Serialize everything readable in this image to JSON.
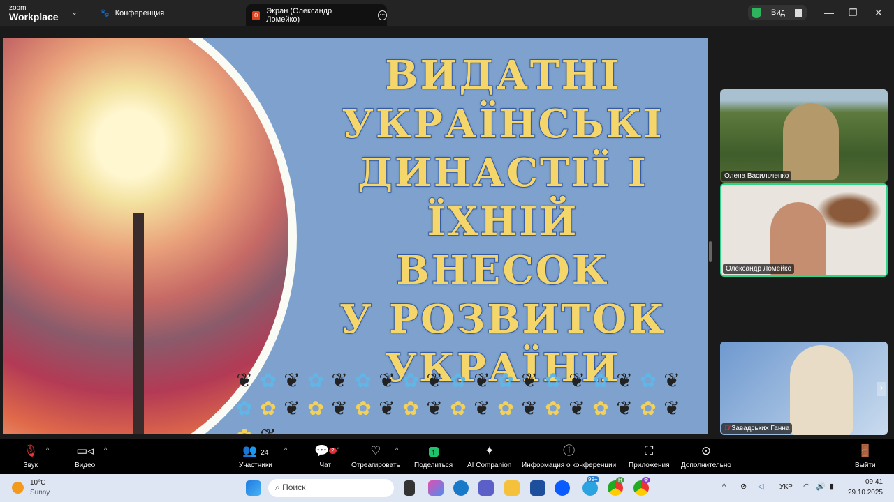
{
  "titlebar": {
    "logo_small": "zoom",
    "logo_big": "Workplace",
    "meeting": "Конференция",
    "share_tab": "Экран (Олександр Ломейко)",
    "share_badge": "0",
    "view": "Вид"
  },
  "slide": {
    "title_lines": [
      "ВИДАТНІ",
      "УКРАЇНСЬКІ",
      "ДИНАСТІЇ І ЇХНІЙ",
      "ВНЕСОК",
      "У РОЗВИТОК",
      "УКРАЇНИ"
    ],
    "title_color": "#f5d66a",
    "bg": "#7ea2cd"
  },
  "participants": [
    {
      "name": "Олена Васильченко"
    },
    {
      "name": "Олександр Ломейко"
    },
    {
      "name": "Завадських Ганна"
    }
  ],
  "toolbar": {
    "audio": "Звук",
    "video": "Видео",
    "participants": "Участники",
    "participants_count": "24",
    "chat": "Чат",
    "chat_badge": "2",
    "react": "Отреагировать",
    "share": "Поделиться",
    "ai": "AI Companion",
    "info": "Информация о конференции",
    "apps": "Приложения",
    "more": "Дополнительно",
    "leave": "Выйти"
  },
  "taskbar": {
    "temp": "10°C",
    "weather": "Sunny",
    "search_placeholder": "Поиск",
    "telegram_badge": "99+",
    "chrome1_badge": "Н",
    "chrome2_badge": "Ф",
    "lang": "УКР",
    "time": "09:41",
    "date": "29.10.2025"
  }
}
